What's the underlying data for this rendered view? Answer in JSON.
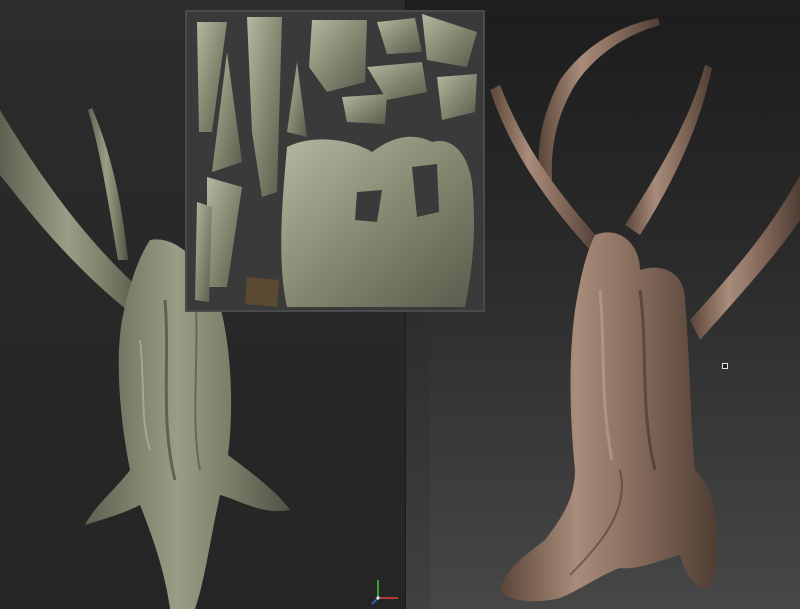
{
  "viewports": {
    "left": {
      "mode": "textured-preview"
    },
    "right": {
      "mode": "sculpt-clay"
    }
  },
  "uv_editor": {
    "shells": [
      "branch-shell",
      "trunk-shell",
      "root-shell",
      "bark-chunk-shell"
    ]
  },
  "colors": {
    "bark_texture": "#8f9279",
    "bark_dark": "#4a4c3c",
    "clay": "#8a6f60",
    "clay_highlight": "#b39886",
    "clay_shadow": "#5a4539",
    "uv_background": "#3a3a3a"
  },
  "icons": {
    "gizmo": "axis-gizmo-icon",
    "cursor": "cursor-marker-icon"
  }
}
